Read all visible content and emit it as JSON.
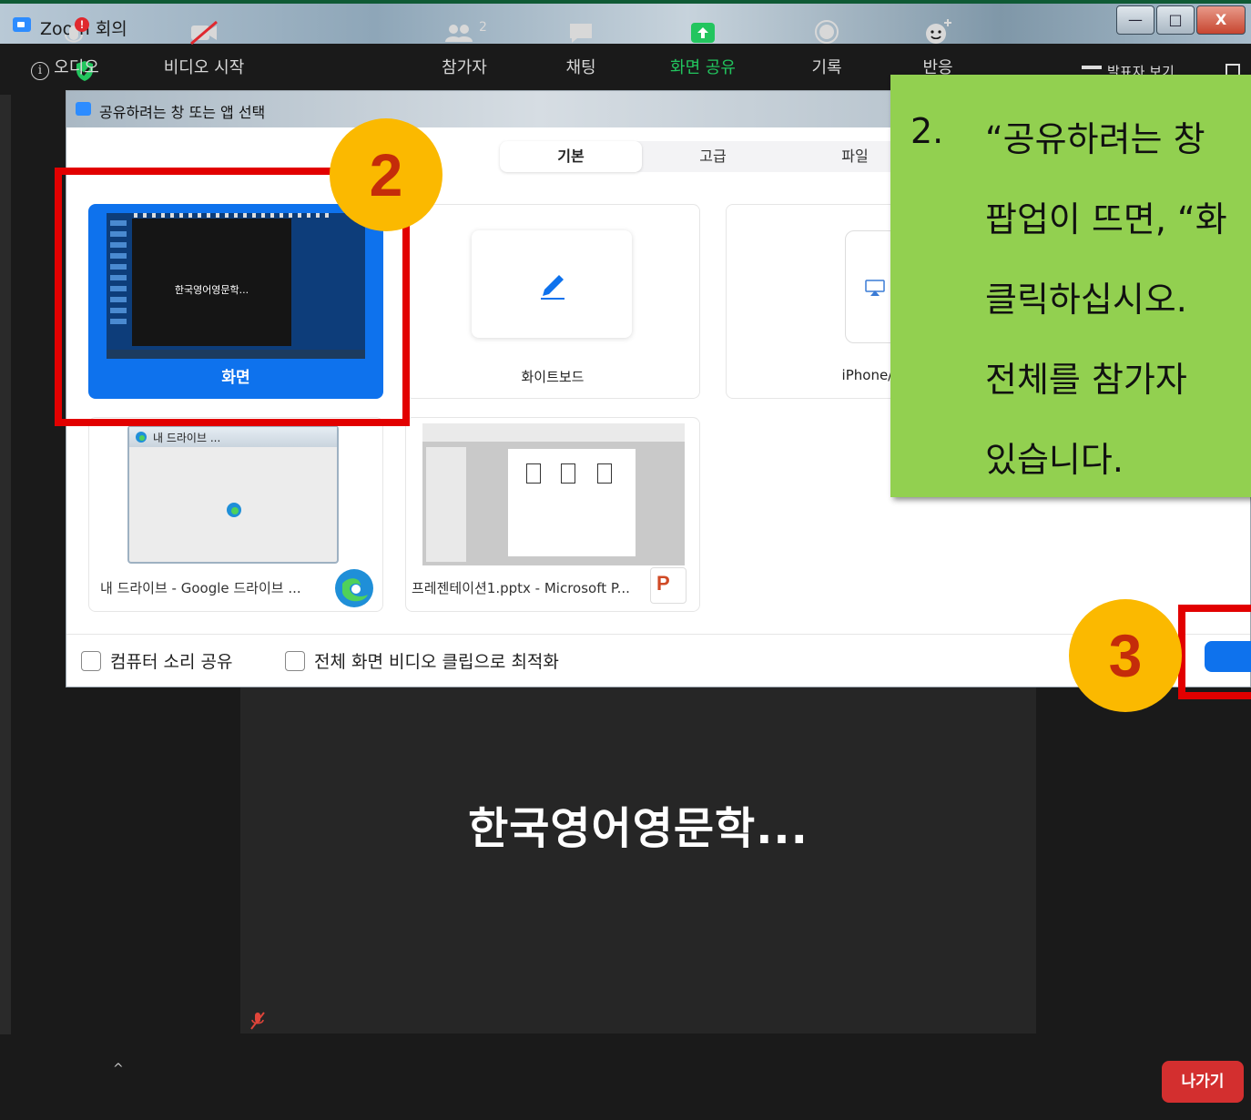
{
  "window": {
    "title": "Zoom 회의",
    "minimize_label": "—",
    "maximize_label": "□",
    "close_label": "X"
  },
  "topbar": {
    "presenter_view": "발표자 보기",
    "shield_color": "#22c55e"
  },
  "dialog": {
    "title": "공유하려는 창 또는 앱 선택",
    "tabs": [
      {
        "label": "기본",
        "active": true
      },
      {
        "label": "고급",
        "active": false
      },
      {
        "label": "파일",
        "active": false
      }
    ],
    "cards": {
      "screen": {
        "label": "화면",
        "thumb_text": "한국영어영문학...",
        "selected": true
      },
      "whiteboard": {
        "label": "화이트보드"
      },
      "iphone": {
        "label": "iPhone/iP"
      },
      "drive": {
        "label": "내 드라이브 - Google 드라이브 ...",
        "thumb_title": "내 드라이브 ..."
      },
      "ppt": {
        "label": "프레젠테이션1.pptx - Microsoft P..."
      }
    },
    "checkboxes": [
      {
        "label": "컴퓨터 소리 공유",
        "checked": false
      },
      {
        "label": "전체 화면 비디오 클립으로 최적화",
        "checked": false
      }
    ]
  },
  "annotations": {
    "badge_2": "2",
    "badge_3": "3",
    "callout": {
      "number": "2.",
      "lines": [
        "“공유하려는 창",
        "팝업이 뜨면, “화",
        "클릭하십시오.",
        "전체를 참가자",
        "있습니다."
      ]
    },
    "colors": {
      "highlight": "#e20000",
      "badge": "#fbb900",
      "callout": "#92d050"
    }
  },
  "meeting": {
    "participant_name": "한국영어영문학..."
  },
  "toolbar": {
    "audio": "오디오",
    "video": "비디오 시작",
    "participants": "참가자",
    "participants_count": "2",
    "chat": "채팅",
    "share": "화면 공유",
    "record": "기록",
    "reactions": "반응",
    "leave": "나가기"
  }
}
